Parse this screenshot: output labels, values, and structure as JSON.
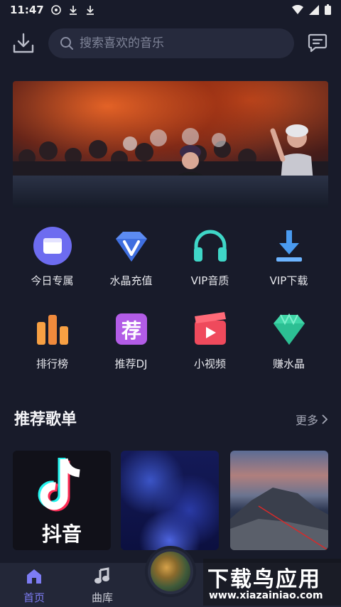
{
  "status_bar": {
    "time": "11:47"
  },
  "header": {
    "search_placeholder": "搜索喜欢的音乐"
  },
  "features": [
    {
      "label": "今日专属",
      "icon": "daily-exclusive-icon",
      "color": "#6d6cf0"
    },
    {
      "label": "水晶充值",
      "icon": "crystal-recharge-icon",
      "color": "#5c8bf2"
    },
    {
      "label": "VIP音质",
      "icon": "headphones-icon",
      "color": "#3fd6c7"
    },
    {
      "label": "VIP下载",
      "icon": "download-icon",
      "color": "#4a9bf0"
    },
    {
      "label": "排行榜",
      "icon": "chart-bars-icon",
      "color": "#f08a3c"
    },
    {
      "label": "推荐DJ",
      "icon": "recommend-dj-icon",
      "color": "#b25ce6"
    },
    {
      "label": "小视频",
      "icon": "short-video-icon",
      "color": "#ef4a5c"
    },
    {
      "label": "赚水晶",
      "icon": "earn-crystal-icon",
      "color": "#3fd6a8"
    }
  ],
  "section": {
    "title": "推荐歌单",
    "more": "更多"
  },
  "playlists": [
    {
      "name": "douyin-playlist",
      "text": "抖音"
    },
    {
      "name": "blue-lights-playlist"
    },
    {
      "name": "coast-rocks-playlist"
    }
  ],
  "tabs": [
    {
      "label": "首页",
      "active": true
    },
    {
      "label": "曲库",
      "active": false
    }
  ],
  "watermark": {
    "title": "下载鸟应用",
    "url": "www.xiazainiao.com"
  }
}
